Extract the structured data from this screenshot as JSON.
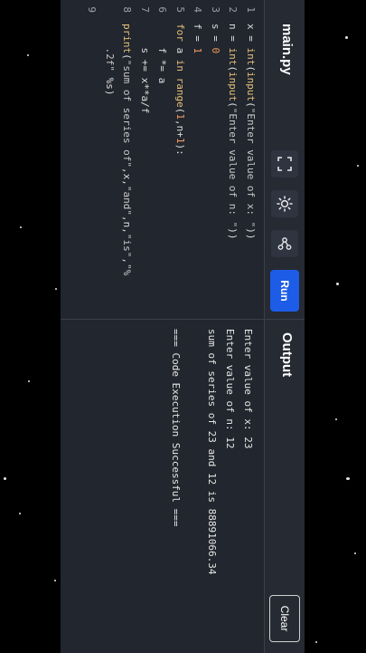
{
  "editor": {
    "file_name": "main.py",
    "run_label": "Run",
    "toolbar_icons": [
      "fullscreen-icon",
      "theme-sun-icon",
      "share-icon"
    ],
    "lines": [
      {
        "n": "1",
        "parts": [
          [
            "t",
            "x = "
          ],
          [
            "fn",
            "int"
          ],
          [
            "t",
            "("
          ],
          [
            "fn",
            "input"
          ],
          [
            "t",
            "("
          ],
          [
            "str",
            "\"Enter value of x: \""
          ],
          [
            "t",
            "))"
          ]
        ]
      },
      {
        "n": "2",
        "parts": [
          [
            "t",
            "n = "
          ],
          [
            "fn",
            "int"
          ],
          [
            "t",
            "("
          ],
          [
            "fn",
            "input"
          ],
          [
            "t",
            "("
          ],
          [
            "str",
            "\"Enter value of n: \""
          ],
          [
            "t",
            "))"
          ]
        ]
      },
      {
        "n": "3",
        "parts": [
          [
            "t",
            "s = "
          ],
          [
            "num",
            "0"
          ]
        ]
      },
      {
        "n": "4",
        "parts": [
          [
            "t",
            "f = "
          ],
          [
            "num",
            "1"
          ]
        ]
      },
      {
        "n": "5",
        "parts": [
          [
            "kw",
            "for"
          ],
          [
            "t",
            " a "
          ],
          [
            "kw",
            "in"
          ],
          [
            "t",
            " "
          ],
          [
            "fn",
            "range"
          ],
          [
            "t",
            "("
          ],
          [
            "num",
            "1"
          ],
          [
            "t",
            ",n+"
          ],
          [
            "num",
            "1"
          ],
          [
            "t",
            "):"
          ]
        ]
      },
      {
        "n": "6",
        "parts": [
          [
            "t",
            "    f *= a"
          ]
        ]
      },
      {
        "n": "7",
        "parts": [
          [
            "t",
            "    s += x**a/f"
          ]
        ]
      },
      {
        "n": "8",
        "parts": [
          [
            "fn",
            "print"
          ],
          [
            "t",
            "("
          ],
          [
            "str",
            "\"sum of series of\""
          ],
          [
            "t",
            ",x,"
          ],
          [
            "str",
            "\"and\""
          ],
          [
            "t",
            ",n,"
          ],
          [
            "str",
            "\"is\""
          ],
          [
            "t",
            ","
          ],
          [
            "str",
            "\"%"
          ]
        ]
      },
      {
        "n": "",
        "parts": [
          [
            "str",
            "    .2f\""
          ],
          [
            "t",
            " %s)"
          ]
        ]
      },
      {
        "n": "9",
        "parts": []
      }
    ]
  },
  "output": {
    "title": "Output",
    "clear_label": "Clear",
    "lines": [
      "Enter value of x: 23",
      "Enter value of n: 12",
      "sum of series of 23 and 12 is 88891066.34",
      "",
      "=== Code Execution Successful ==="
    ]
  },
  "colors": {
    "background": "#000000",
    "panel": "#22262e",
    "run_button": "#1d5ce6",
    "keyword": "#e5c07b",
    "number": "#f09a5d"
  }
}
